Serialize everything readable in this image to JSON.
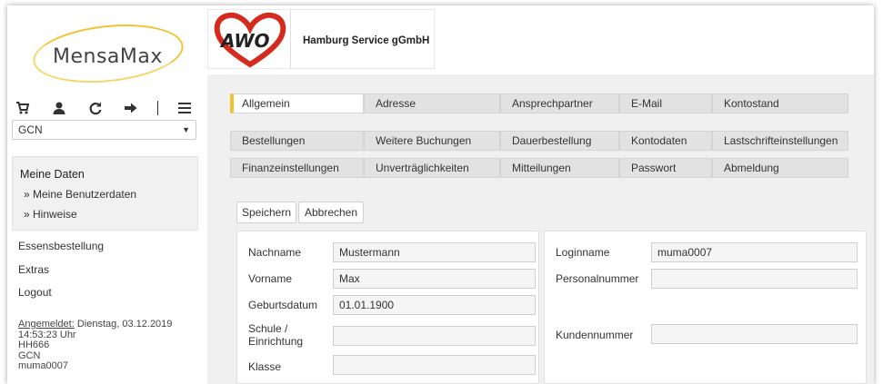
{
  "app": {
    "logo_text": "MensaMax"
  },
  "header": {
    "awo_logo": "AWO",
    "company": "Hamburg Service gGmbH"
  },
  "toolbar": {
    "icons": [
      "cart-icon",
      "user-icon",
      "refresh-icon",
      "sign-out-icon",
      "menu-icon"
    ]
  },
  "sidebar": {
    "select_value": "GCN",
    "meine_daten": {
      "title": "Meine Daten",
      "items": [
        "» Meine Benutzerdaten",
        "» Hinweise"
      ]
    },
    "links": [
      "Essensbestellung",
      "Extras",
      "Logout"
    ],
    "status": {
      "label": "Angemeldet:",
      "date": "Dienstag, 03.12.2019",
      "time": "14:53:23 Uhr",
      "line3": "HH666",
      "line4": "GCN",
      "line5": "muma0007"
    }
  },
  "tabs": [
    [
      "Allgemein",
      "Adresse",
      "Ansprechpartner",
      "E-Mail",
      "Kontostand"
    ],
    [
      "Bestellungen",
      "Weitere Buchungen",
      "Dauerbestellung",
      "Kontodaten",
      "Lastschrifteinstellungen"
    ],
    [
      "Finanzeinstellungen",
      "Unverträglichkeiten",
      "Mitteilungen",
      "Passwort",
      "Abmeldung"
    ]
  ],
  "actions": {
    "save": "Speichern",
    "cancel": "Abbrechen"
  },
  "form_left": {
    "nachname": {
      "label": "Nachname",
      "value": "Mustermann"
    },
    "vorname": {
      "label": "Vorname",
      "value": "Max"
    },
    "geburtsdatum": {
      "label": "Geburtsdatum",
      "value": "01.01.1900"
    },
    "schule": {
      "label1": "Schule /",
      "label2": "Einrichtung",
      "value": ""
    },
    "klasse": {
      "label": "Klasse",
      "value": ""
    }
  },
  "form_right": {
    "loginname": {
      "label": "Loginname",
      "value": "muma0007"
    },
    "personalnummer": {
      "label": "Personalnummer",
      "value": ""
    },
    "kundennummer": {
      "label": "Kundennummer",
      "value": ""
    }
  },
  "colors": {
    "accent": "#f2c230",
    "awo_red": "#d52b1e"
  }
}
